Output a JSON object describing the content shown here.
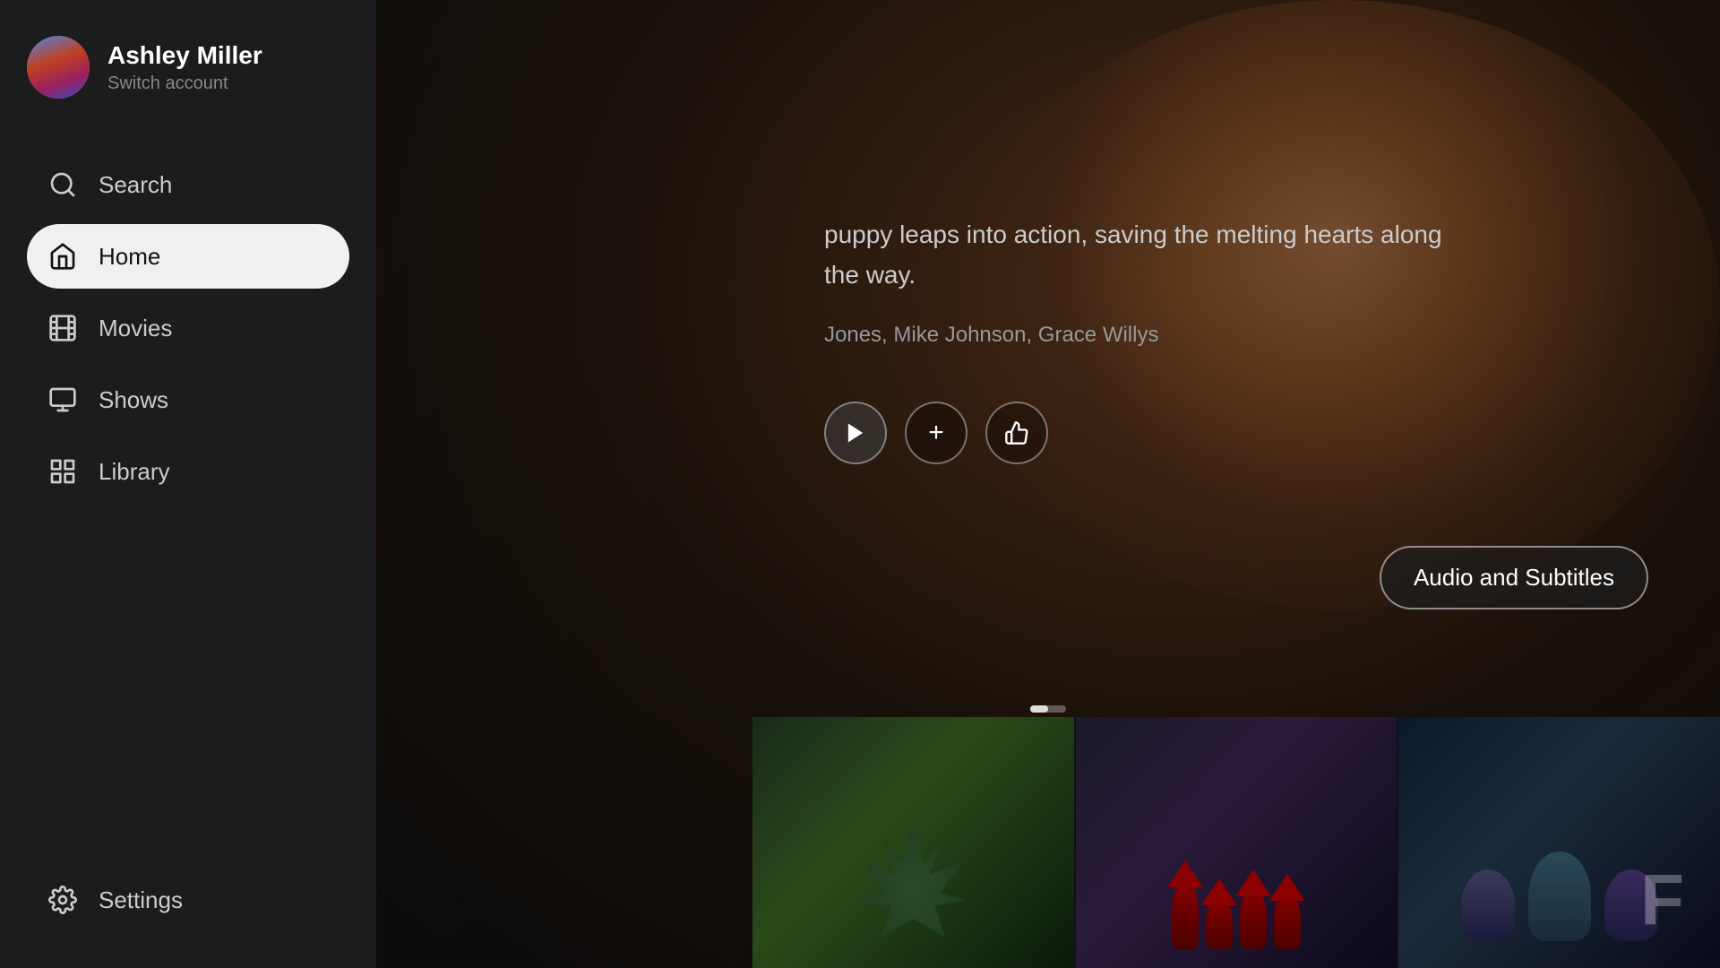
{
  "user": {
    "name": "Ashley Miller",
    "switch_label": "Switch account"
  },
  "nav": {
    "items": [
      {
        "id": "search",
        "label": "Search",
        "icon": "search-icon",
        "active": false
      },
      {
        "id": "home",
        "label": "Home",
        "icon": "home-icon",
        "active": true
      },
      {
        "id": "movies",
        "label": "Movies",
        "icon": "movies-icon",
        "active": false
      },
      {
        "id": "shows",
        "label": "Shows",
        "icon": "shows-icon",
        "active": false
      },
      {
        "id": "library",
        "label": "Library",
        "icon": "library-icon",
        "active": false
      }
    ],
    "settings": {
      "id": "settings",
      "label": "Settings",
      "icon": "settings-icon"
    }
  },
  "hero": {
    "description": "puppy leaps into action, saving the melting hearts along the way.",
    "cast": "Jones, Mike Johnson, Grace Willys",
    "buttons": {
      "add": "+",
      "like": "👍"
    },
    "audio_subtitles_label": "Audio and Subtitles"
  },
  "thumbnails": [
    {
      "id": "thumb-1",
      "alt": "Spiky creature in forest"
    },
    {
      "id": "thumb-2",
      "alt": "Group of gnomes"
    },
    {
      "id": "thumb-3",
      "alt": "Animals with glasses"
    }
  ]
}
